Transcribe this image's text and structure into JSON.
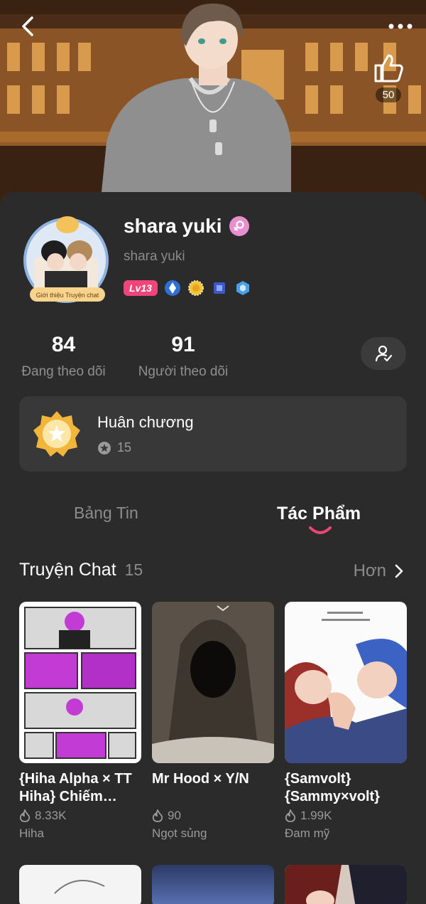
{
  "header": {
    "like_count": "50"
  },
  "profile": {
    "name": "shara yuki",
    "handle": "shara yuki",
    "level": "Lv13",
    "avatar_caption": "Giới thiệu Truyện chat"
  },
  "stats": [
    {
      "value": "84",
      "label": "Đang theo dõi"
    },
    {
      "value": "91",
      "label": "Người theo dõi"
    }
  ],
  "medal": {
    "title": "Huân chương",
    "count": "15"
  },
  "tabs": [
    {
      "label": "Bảng Tin",
      "active": false
    },
    {
      "label": "Tác Phẩm",
      "active": true
    }
  ],
  "section": {
    "title": "Truyện Chat",
    "count": "15",
    "more_label": "Hơn"
  },
  "stories": [
    {
      "title": "{Hiha Alpha × TT Hiha} Chiếm…",
      "views": "8.33K",
      "author": "Hiha"
    },
    {
      "title": "Mr Hood × Y/N",
      "views": "90",
      "author": "Ngọt sủng"
    },
    {
      "title": "{Samvolt} {Sammy×volt} S…",
      "views": "1.99K",
      "author": "Đam mỹ"
    }
  ],
  "colors": {
    "accent_pink": "#f0457a",
    "gender_badge": "#e98fd0",
    "background": "#2b2b2b",
    "card": "#383838"
  }
}
